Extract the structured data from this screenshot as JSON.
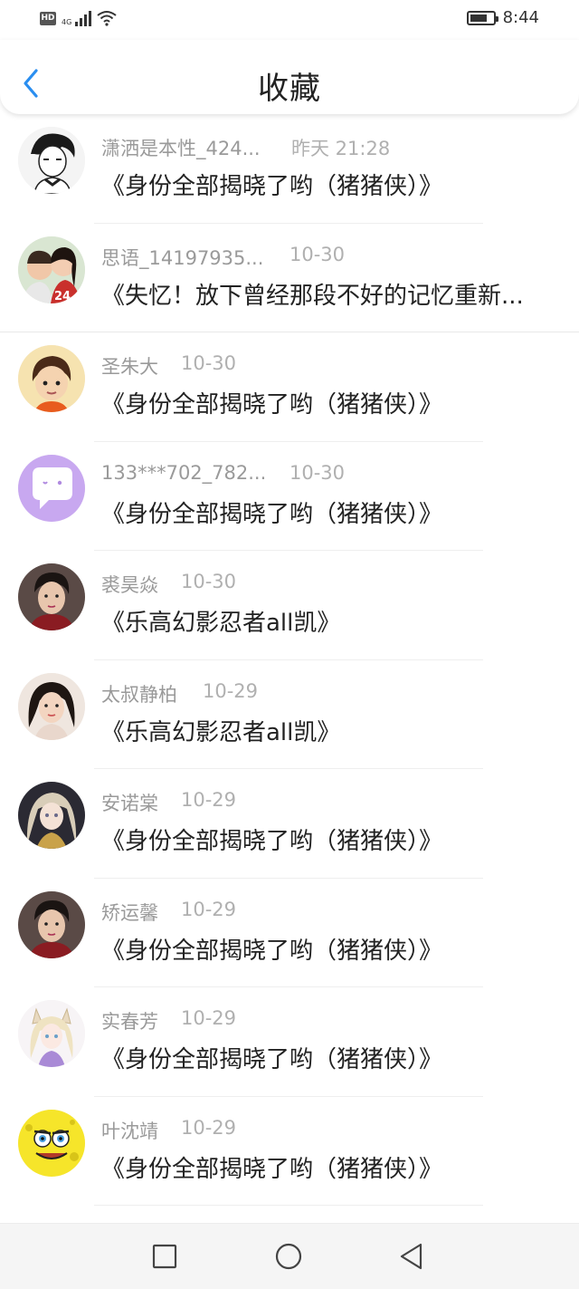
{
  "status_bar": {
    "hd": "HD",
    "network": "4G",
    "time": "8:44"
  },
  "header": {
    "title": "收藏"
  },
  "items": [
    {
      "name": "潇洒是本性_424...",
      "time": "昨天 21:28",
      "title": "《身份全部揭晓了哟（猪猪侠）》",
      "avatar": "boy-manga-avatar"
    },
    {
      "name": "思语_14197935...",
      "time": "10-30",
      "title": "《失忆！放下曾经那段不好的记忆重新...",
      "avatar": "two-girls-avatar"
    },
    {
      "name": "圣朱大",
      "time": "10-30",
      "title": "《身份全部揭晓了哟（猪猪侠）》",
      "avatar": "cartoon-boy-avatar"
    },
    {
      "name": "133***702_782...",
      "time": "10-30",
      "title": "《身份全部揭晓了哟（猪猪侠）》",
      "avatar": "chat-bubble-avatar"
    },
    {
      "name": "裘昊焱",
      "time": "10-30",
      "title": "《乐高幻影忍者all凯》",
      "avatar": "man-portrait-avatar"
    },
    {
      "name": "太叔静柏",
      "time": "10-29",
      "title": "《乐高幻影忍者all凯》",
      "avatar": "woman-portrait-avatar"
    },
    {
      "name": "安诺棠",
      "time": "10-29",
      "title": "《身份全部揭晓了哟（猪猪侠）》",
      "avatar": "anime-girl-avatar"
    },
    {
      "name": "矫运馨",
      "time": "10-29",
      "title": "《身份全部揭晓了哟（猪猪侠）》",
      "avatar": "man-portrait-avatar"
    },
    {
      "name": "实春芳",
      "time": "10-29",
      "title": "《身份全部揭晓了哟（猪猪侠）》",
      "avatar": "anime-catgirl-avatar"
    },
    {
      "name": "叶沈靖",
      "time": "10-29",
      "title": "《身份全部揭晓了哟（猪猪侠）》",
      "avatar": "spongebob-avatar"
    }
  ],
  "colors": {
    "accent": "#2a8ef0",
    "name_text": "#9a9a9a",
    "title_text": "#222222"
  }
}
